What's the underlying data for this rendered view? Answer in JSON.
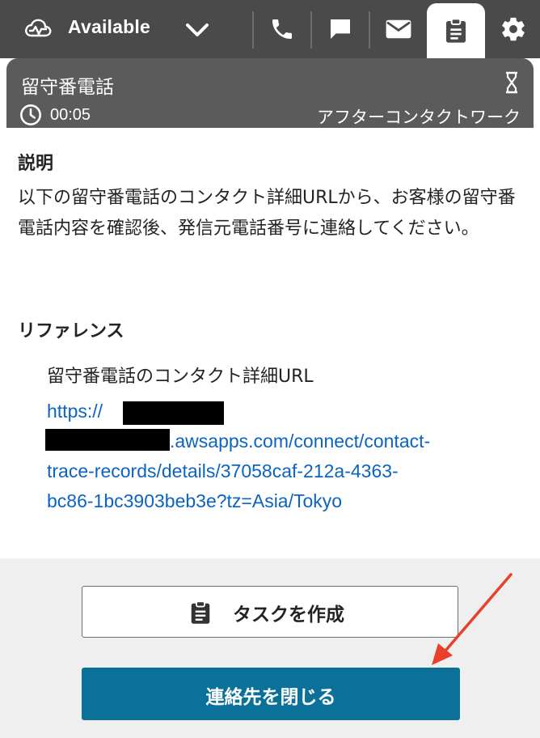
{
  "topbar": {
    "status_label": "Available",
    "status_icon": "agent-status-icon",
    "buttons": [
      {
        "name": "phone-icon"
      },
      {
        "name": "chat-icon"
      },
      {
        "name": "mail-icon"
      },
      {
        "name": "task-clipboard-icon",
        "active": true
      },
      {
        "name": "gear-icon"
      }
    ]
  },
  "contact": {
    "title": "留守番電話",
    "timer": "00:05",
    "state": "アフターコンタクトワーク"
  },
  "description": {
    "heading": "説明",
    "text": "以下の留守番電話のコンタクト詳細URLから、お客様の留守番電話内容を確認後、発信元電話番号に連絡してください。"
  },
  "references": {
    "heading": "リファレンス",
    "label": "留守番電話のコンタクト詳細URL",
    "link_lines": [
      "https://",
      ".awsapps.com/connect/contact-",
      "trace-records/details/37058caf-212a-4363-",
      "bc86-1bc3903beb3e?tz=Asia/Tokyo"
    ]
  },
  "footer": {
    "create_task_label": "タスクを作成",
    "close_contact_label": "連絡先を閉じる"
  },
  "colors": {
    "topbar_bg": "#4a4a4a",
    "contact_bg": "#5b5b5b",
    "link": "#0b64c0",
    "primary_button": "#0b7199",
    "annotation_arrow": "#e8402b"
  }
}
